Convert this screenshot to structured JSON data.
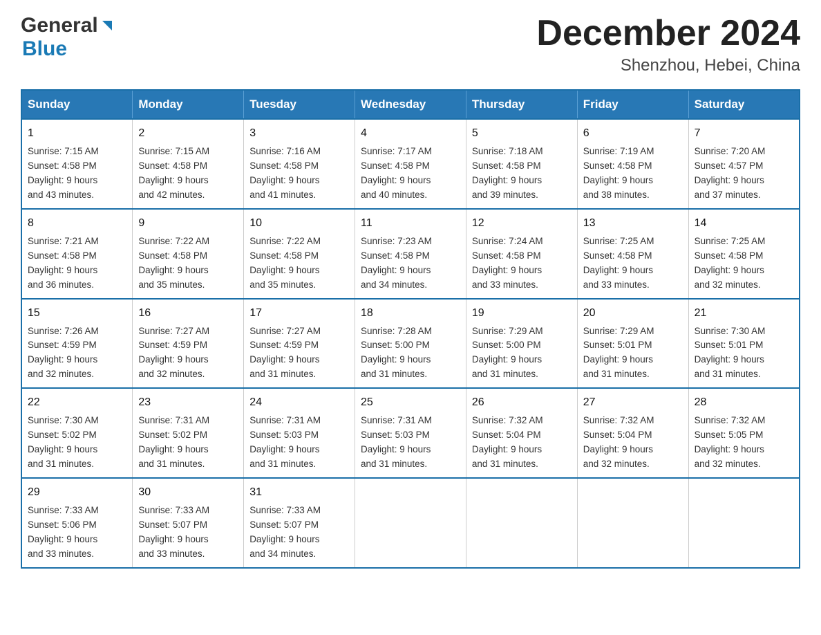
{
  "header": {
    "logo_general": "General",
    "logo_blue": "Blue",
    "month_title": "December 2024",
    "subtitle": "Shenzhou, Hebei, China"
  },
  "weekdays": [
    "Sunday",
    "Monday",
    "Tuesday",
    "Wednesday",
    "Thursday",
    "Friday",
    "Saturday"
  ],
  "weeks": [
    [
      {
        "day": "1",
        "sunrise": "7:15 AM",
        "sunset": "4:58 PM",
        "daylight": "9 hours and 43 minutes."
      },
      {
        "day": "2",
        "sunrise": "7:15 AM",
        "sunset": "4:58 PM",
        "daylight": "9 hours and 42 minutes."
      },
      {
        "day": "3",
        "sunrise": "7:16 AM",
        "sunset": "4:58 PM",
        "daylight": "9 hours and 41 minutes."
      },
      {
        "day": "4",
        "sunrise": "7:17 AM",
        "sunset": "4:58 PM",
        "daylight": "9 hours and 40 minutes."
      },
      {
        "day": "5",
        "sunrise": "7:18 AM",
        "sunset": "4:58 PM",
        "daylight": "9 hours and 39 minutes."
      },
      {
        "day": "6",
        "sunrise": "7:19 AM",
        "sunset": "4:58 PM",
        "daylight": "9 hours and 38 minutes."
      },
      {
        "day": "7",
        "sunrise": "7:20 AM",
        "sunset": "4:57 PM",
        "daylight": "9 hours and 37 minutes."
      }
    ],
    [
      {
        "day": "8",
        "sunrise": "7:21 AM",
        "sunset": "4:58 PM",
        "daylight": "9 hours and 36 minutes."
      },
      {
        "day": "9",
        "sunrise": "7:22 AM",
        "sunset": "4:58 PM",
        "daylight": "9 hours and 35 minutes."
      },
      {
        "day": "10",
        "sunrise": "7:22 AM",
        "sunset": "4:58 PM",
        "daylight": "9 hours and 35 minutes."
      },
      {
        "day": "11",
        "sunrise": "7:23 AM",
        "sunset": "4:58 PM",
        "daylight": "9 hours and 34 minutes."
      },
      {
        "day": "12",
        "sunrise": "7:24 AM",
        "sunset": "4:58 PM",
        "daylight": "9 hours and 33 minutes."
      },
      {
        "day": "13",
        "sunrise": "7:25 AM",
        "sunset": "4:58 PM",
        "daylight": "9 hours and 33 minutes."
      },
      {
        "day": "14",
        "sunrise": "7:25 AM",
        "sunset": "4:58 PM",
        "daylight": "9 hours and 32 minutes."
      }
    ],
    [
      {
        "day": "15",
        "sunrise": "7:26 AM",
        "sunset": "4:59 PM",
        "daylight": "9 hours and 32 minutes."
      },
      {
        "day": "16",
        "sunrise": "7:27 AM",
        "sunset": "4:59 PM",
        "daylight": "9 hours and 32 minutes."
      },
      {
        "day": "17",
        "sunrise": "7:27 AM",
        "sunset": "4:59 PM",
        "daylight": "9 hours and 31 minutes."
      },
      {
        "day": "18",
        "sunrise": "7:28 AM",
        "sunset": "5:00 PM",
        "daylight": "9 hours and 31 minutes."
      },
      {
        "day": "19",
        "sunrise": "7:29 AM",
        "sunset": "5:00 PM",
        "daylight": "9 hours and 31 minutes."
      },
      {
        "day": "20",
        "sunrise": "7:29 AM",
        "sunset": "5:01 PM",
        "daylight": "9 hours and 31 minutes."
      },
      {
        "day": "21",
        "sunrise": "7:30 AM",
        "sunset": "5:01 PM",
        "daylight": "9 hours and 31 minutes."
      }
    ],
    [
      {
        "day": "22",
        "sunrise": "7:30 AM",
        "sunset": "5:02 PM",
        "daylight": "9 hours and 31 minutes."
      },
      {
        "day": "23",
        "sunrise": "7:31 AM",
        "sunset": "5:02 PM",
        "daylight": "9 hours and 31 minutes."
      },
      {
        "day": "24",
        "sunrise": "7:31 AM",
        "sunset": "5:03 PM",
        "daylight": "9 hours and 31 minutes."
      },
      {
        "day": "25",
        "sunrise": "7:31 AM",
        "sunset": "5:03 PM",
        "daylight": "9 hours and 31 minutes."
      },
      {
        "day": "26",
        "sunrise": "7:32 AM",
        "sunset": "5:04 PM",
        "daylight": "9 hours and 31 minutes."
      },
      {
        "day": "27",
        "sunrise": "7:32 AM",
        "sunset": "5:04 PM",
        "daylight": "9 hours and 32 minutes."
      },
      {
        "day": "28",
        "sunrise": "7:32 AM",
        "sunset": "5:05 PM",
        "daylight": "9 hours and 32 minutes."
      }
    ],
    [
      {
        "day": "29",
        "sunrise": "7:33 AM",
        "sunset": "5:06 PM",
        "daylight": "9 hours and 33 minutes."
      },
      {
        "day": "30",
        "sunrise": "7:33 AM",
        "sunset": "5:07 PM",
        "daylight": "9 hours and 33 minutes."
      },
      {
        "day": "31",
        "sunrise": "7:33 AM",
        "sunset": "5:07 PM",
        "daylight": "9 hours and 34 minutes."
      },
      null,
      null,
      null,
      null
    ]
  ]
}
